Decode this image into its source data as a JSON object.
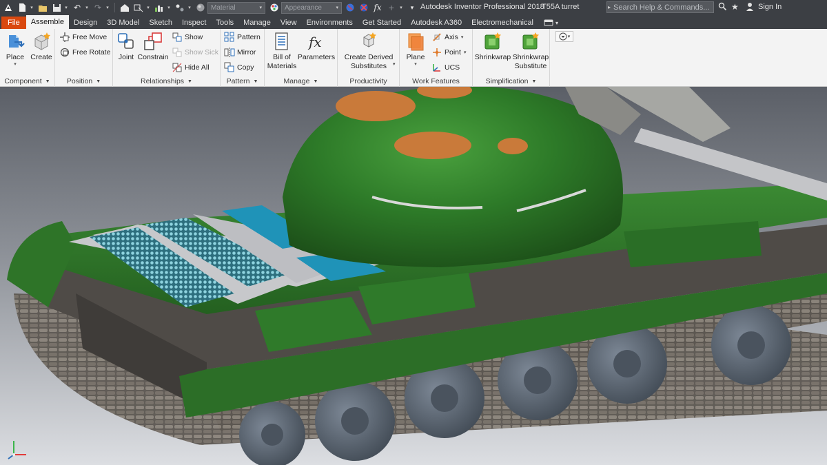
{
  "app": {
    "title": "Autodesk Inventor Professional 2018",
    "document": "T55A turret"
  },
  "quick_access": {
    "material_placeholder": "Material",
    "appearance_placeholder": "Appearance",
    "formula_icon": "fx"
  },
  "search": {
    "placeholder": "Search Help & Commands..."
  },
  "account": {
    "signin_label": "Sign In"
  },
  "tabs": [
    {
      "label": "File"
    },
    {
      "label": "Assemble",
      "active": true
    },
    {
      "label": "Design"
    },
    {
      "label": "3D Model"
    },
    {
      "label": "Sketch"
    },
    {
      "label": "Inspect"
    },
    {
      "label": "Tools"
    },
    {
      "label": "Manage"
    },
    {
      "label": "View"
    },
    {
      "label": "Environments"
    },
    {
      "label": "Get Started"
    },
    {
      "label": "Autodesk A360"
    },
    {
      "label": "Electromechanical"
    }
  ],
  "ribbon": {
    "component": {
      "title": "Component",
      "place": "Place",
      "create": "Create"
    },
    "position": {
      "title": "Position",
      "free_move": "Free Move",
      "free_rotate": "Free Rotate"
    },
    "relationships": {
      "title": "Relationships",
      "joint": "Joint",
      "constrain": "Constrain",
      "show": "Show",
      "show_sick": "Show Sick",
      "hide_all": "Hide All"
    },
    "pattern": {
      "title": "Pattern",
      "pattern": "Pattern",
      "mirror": "Mirror",
      "copy": "Copy"
    },
    "manage": {
      "title": "Manage",
      "bom_line1": "Bill of",
      "bom_line2": "Materials",
      "parameters": "Parameters"
    },
    "productivity": {
      "title": "Productivity",
      "derived_line1": "Create Derived",
      "derived_line2": "Substitutes"
    },
    "work_features": {
      "title": "Work Features",
      "plane": "Plane",
      "axis": "Axis",
      "point": "Point",
      "ucs": "UCS"
    },
    "simplification": {
      "title": "Simplification",
      "shrinkwrap": "Shrinkwrap",
      "shrinkwrap_sub_line1": "Shrinkwrap",
      "shrinkwrap_sub_line2": "Substitute"
    }
  },
  "viewport": {
    "model": "T55A tank assembly",
    "colors": {
      "hull_green": "#2f7a2a",
      "hatch_orange": "#c97a3a",
      "hatch_blue": "#1f93b8",
      "wheel_grey": "#5d6876",
      "track_grey": "#6e6760",
      "background_top": "#5a5e66",
      "background_bottom": "#d7d9dd"
    }
  },
  "colors": {
    "file_tab": "#d9480f",
    "titlebar": "#3c3f44",
    "ribbon": "#f3f3f3"
  }
}
